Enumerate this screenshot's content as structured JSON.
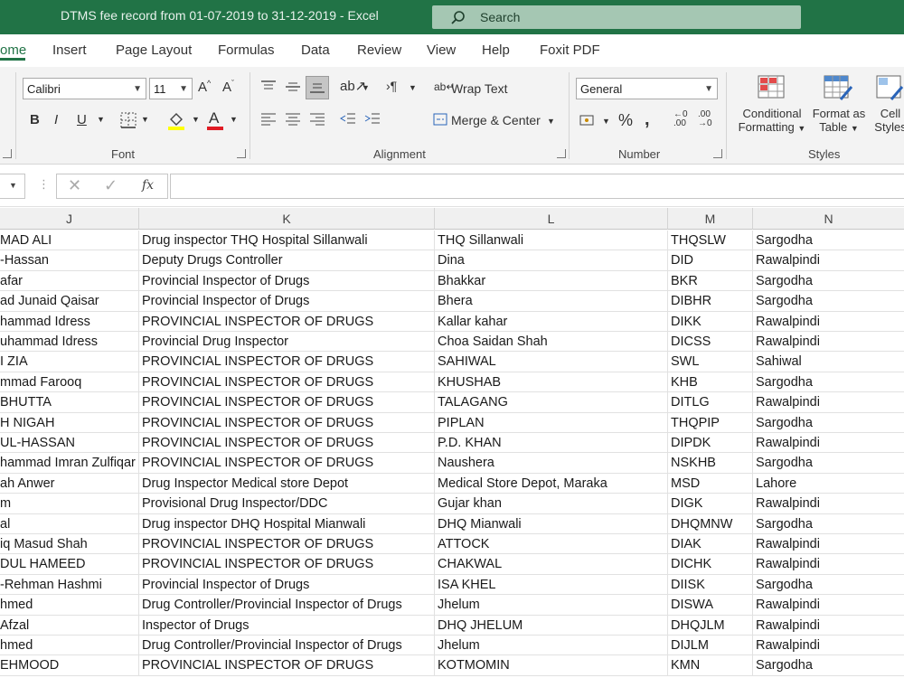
{
  "window": {
    "title": "DTMS fee record from 01-07-2019 to 31-12-2019  -  Excel",
    "search_placeholder": "Search"
  },
  "tabs": [
    "ome",
    "Insert",
    "Page Layout",
    "Formulas",
    "Data",
    "Review",
    "View",
    "Help",
    "Foxit PDF"
  ],
  "ribbon": {
    "font": {
      "name": "Calibri",
      "size": "11",
      "group_label": "Font"
    },
    "alignment": {
      "wrap_text": "Wrap Text",
      "merge_center": "Merge & Center",
      "group_label": "Alignment"
    },
    "number": {
      "format": "General",
      "group_label": "Number"
    },
    "styles": {
      "conditional_1": "Conditional",
      "conditional_2": "Formatting",
      "format_as_1": "Format as",
      "format_as_2": "Table",
      "cell_1": "Cell",
      "cell_2": "Styles",
      "group_label": "Styles"
    }
  },
  "formula_bar": {
    "fx": "fx"
  },
  "columns": [
    "J",
    "K",
    "L",
    "M",
    "N"
  ],
  "rows": [
    [
      "MAD ALI",
      "Drug inspector THQ Hospital Sillanwali",
      "THQ Sillanwali",
      "THQSLW",
      "Sargodha"
    ],
    [
      "-Hassan",
      "Deputy Drugs Controller",
      "Dina",
      "DID",
      "Rawalpindi"
    ],
    [
      "afar",
      "Provincial Inspector of Drugs",
      "Bhakkar",
      "BKR",
      "Sargodha"
    ],
    [
      "ad Junaid Qaisar",
      "Provincial Inspector of Drugs",
      "Bhera",
      "DIBHR",
      "Sargodha"
    ],
    [
      "hammad Idress",
      "PROVINCIAL INSPECTOR OF DRUGS",
      "Kallar kahar",
      "DIKK",
      "Rawalpindi"
    ],
    [
      "uhammad Idress",
      "Provincial Drug Inspector",
      "Choa Saidan Shah",
      "DICSS",
      "Rawalpindi"
    ],
    [
      "I ZIA",
      "PROVINCIAL INSPECTOR OF DRUGS",
      "SAHIWAL",
      "SWL",
      "Sahiwal"
    ],
    [
      "mmad Farooq",
      "PROVINCIAL INSPECTOR OF DRUGS",
      "KHUSHAB",
      "KHB",
      "Sargodha"
    ],
    [
      "BHUTTA",
      "PROVINCIAL INSPECTOR OF DRUGS",
      "TALAGANG",
      "DITLG",
      "Rawalpindi"
    ],
    [
      "H NIGAH",
      "PROVINCIAL INSPECTOR OF DRUGS",
      "PIPLAN",
      "THQPIP",
      "Sargodha"
    ],
    [
      "UL-HASSAN",
      "PROVINCIAL INSPECTOR OF DRUGS",
      "P.D. KHAN",
      "DIPDK",
      "Rawalpindi"
    ],
    [
      "hammad Imran Zulfiqar",
      "PROVINCIAL INSPECTOR OF DRUGS",
      "Naushera",
      "NSKHB",
      "Sargodha"
    ],
    [
      "ah Anwer",
      "Drug Inspector Medical store Depot",
      "Medical Store Depot, Maraka",
      "MSD",
      "Lahore"
    ],
    [
      "m",
      "Provisional Drug Inspector/DDC",
      "Gujar khan",
      "DIGK",
      "Rawalpindi"
    ],
    [
      "al",
      "Drug inspector DHQ Hospital Mianwali",
      "DHQ Mianwali",
      "DHQMNW",
      "Sargodha"
    ],
    [
      "iq Masud Shah",
      "PROVINCIAL INSPECTOR OF DRUGS",
      "ATTOCK",
      "DIAK",
      "Rawalpindi"
    ],
    [
      "DUL HAMEED",
      "PROVINCIAL INSPECTOR OF DRUGS",
      "CHAKWAL",
      "DICHK",
      "Rawalpindi"
    ],
    [
      "-Rehman Hashmi",
      "Provincial Inspector of Drugs",
      "ISA KHEL",
      "DIISK",
      "Sargodha"
    ],
    [
      "hmed",
      "Drug Controller/Provincial Inspector of Drugs",
      "Jhelum",
      "DISWA",
      "Rawalpindi"
    ],
    [
      "Afzal",
      "Inspector of Drugs",
      "DHQ JHELUM",
      "DHQJLM",
      "Rawalpindi"
    ],
    [
      "hmed",
      "Drug Controller/Provincial Inspector of Drugs",
      "Jhelum",
      "DIJLM",
      "Rawalpindi"
    ],
    [
      "EHMOOD",
      "PROVINCIAL INSPECTOR OF DRUGS",
      "KOTMOMIN",
      "KMN",
      "Sargodha"
    ]
  ]
}
